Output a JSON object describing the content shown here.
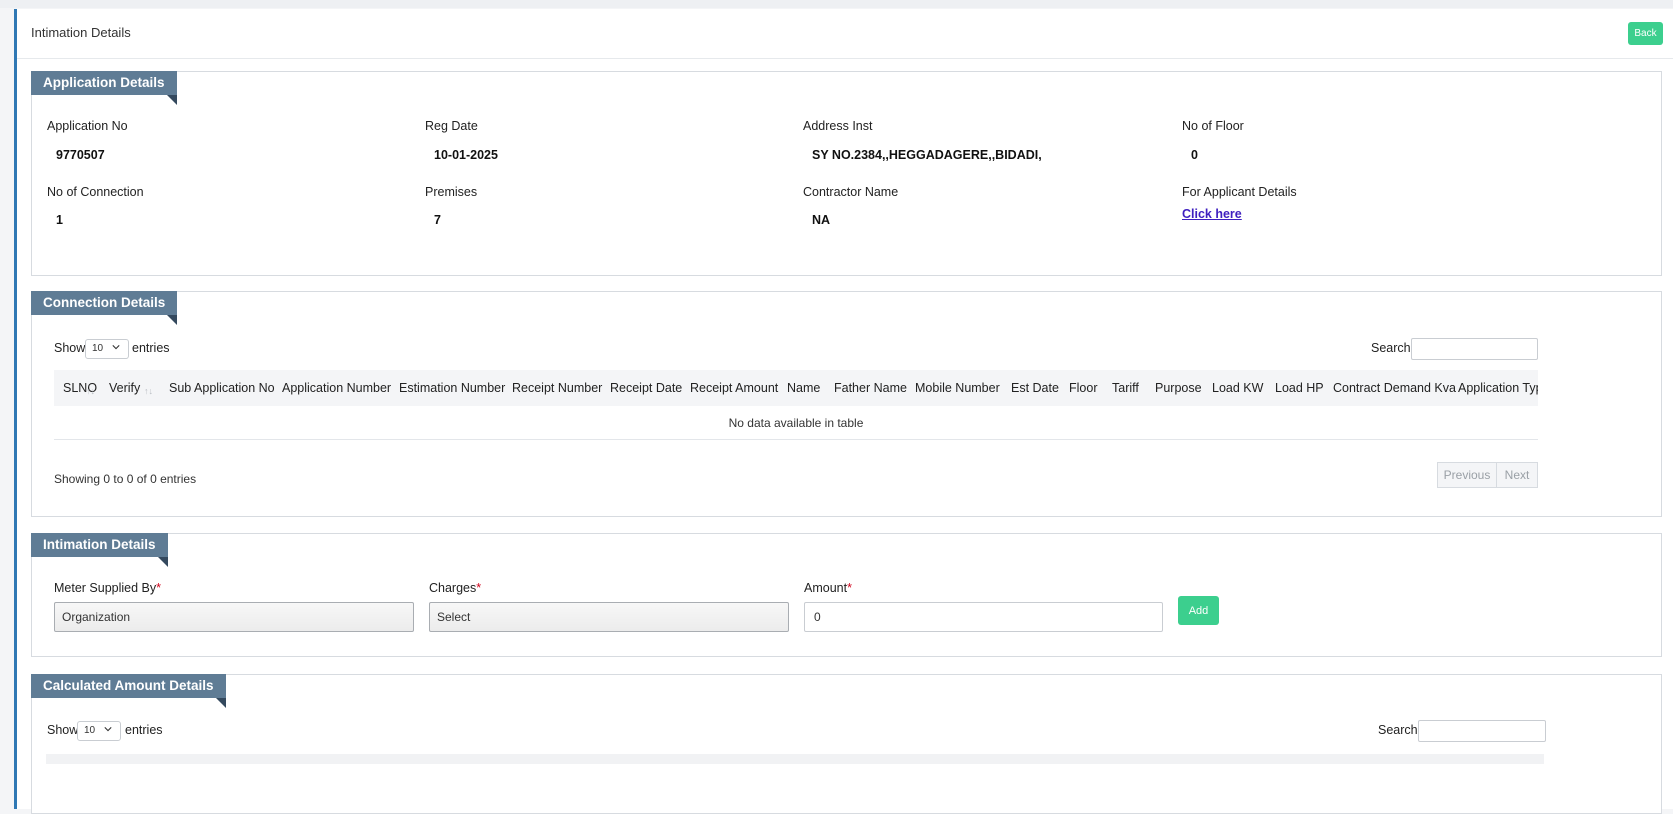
{
  "header": {
    "title": "Intimation Details",
    "back_label": "Back"
  },
  "application_details": {
    "title": "Application Details",
    "fields": [
      {
        "label": "Application No",
        "value": "9770507"
      },
      {
        "label": "Reg Date",
        "value": "10-01-2025"
      },
      {
        "label": "Address Inst",
        "value": "SY NO.2384,,HEGGADAGERE,,BIDADI,"
      },
      {
        "label": "No of Floor",
        "value": "0"
      },
      {
        "label": "No of Connection",
        "value": "1"
      },
      {
        "label": "Premises",
        "value": "7"
      },
      {
        "label": "Contractor Name",
        "value": "NA"
      },
      {
        "label": "For Applicant Details",
        "value": "Click here"
      }
    ]
  },
  "connection_details": {
    "title": "Connection Details",
    "show_label": "Show",
    "entries_label": "entries",
    "page_size": "10",
    "search_label": "Search:",
    "columns": [
      "SLNO",
      "Verify",
      "Sub Application No",
      "Application Number",
      "Estimation Number",
      "Receipt Number",
      "Receipt Date",
      "Receipt Amount",
      "Name",
      "Father Name",
      "Mobile Number",
      "Est Date",
      "Floor",
      "Tariff",
      "Purpose",
      "Load KW",
      "Load HP",
      "Contract Demand Kva",
      "Application Type"
    ],
    "empty_message": "No data available in table",
    "info": "Showing 0 to 0 of 0 entries",
    "prev_label": "Previous",
    "next_label": "Next"
  },
  "intimation_details": {
    "title": "Intimation Details",
    "meter_label": "Meter Supplied By",
    "meter_value": "Organization",
    "charges_label": "Charges",
    "charges_value": "Select",
    "amount_label": "Amount",
    "amount_value": "0",
    "required_mark": "*",
    "add_label": "Add"
  },
  "calculated_amount": {
    "title": "Calculated Amount Details",
    "show_label": "Show",
    "entries_label": "entries",
    "page_size": "10",
    "search_label": "Search:"
  },
  "icons": {
    "chevron": "chevron-down-icon",
    "sort": "sort-icon"
  },
  "colors": {
    "accent": "#2f78b4",
    "panel_tab": "#5f7c95",
    "button_green": "#3ccf8e",
    "link": "#3e1fbf"
  }
}
